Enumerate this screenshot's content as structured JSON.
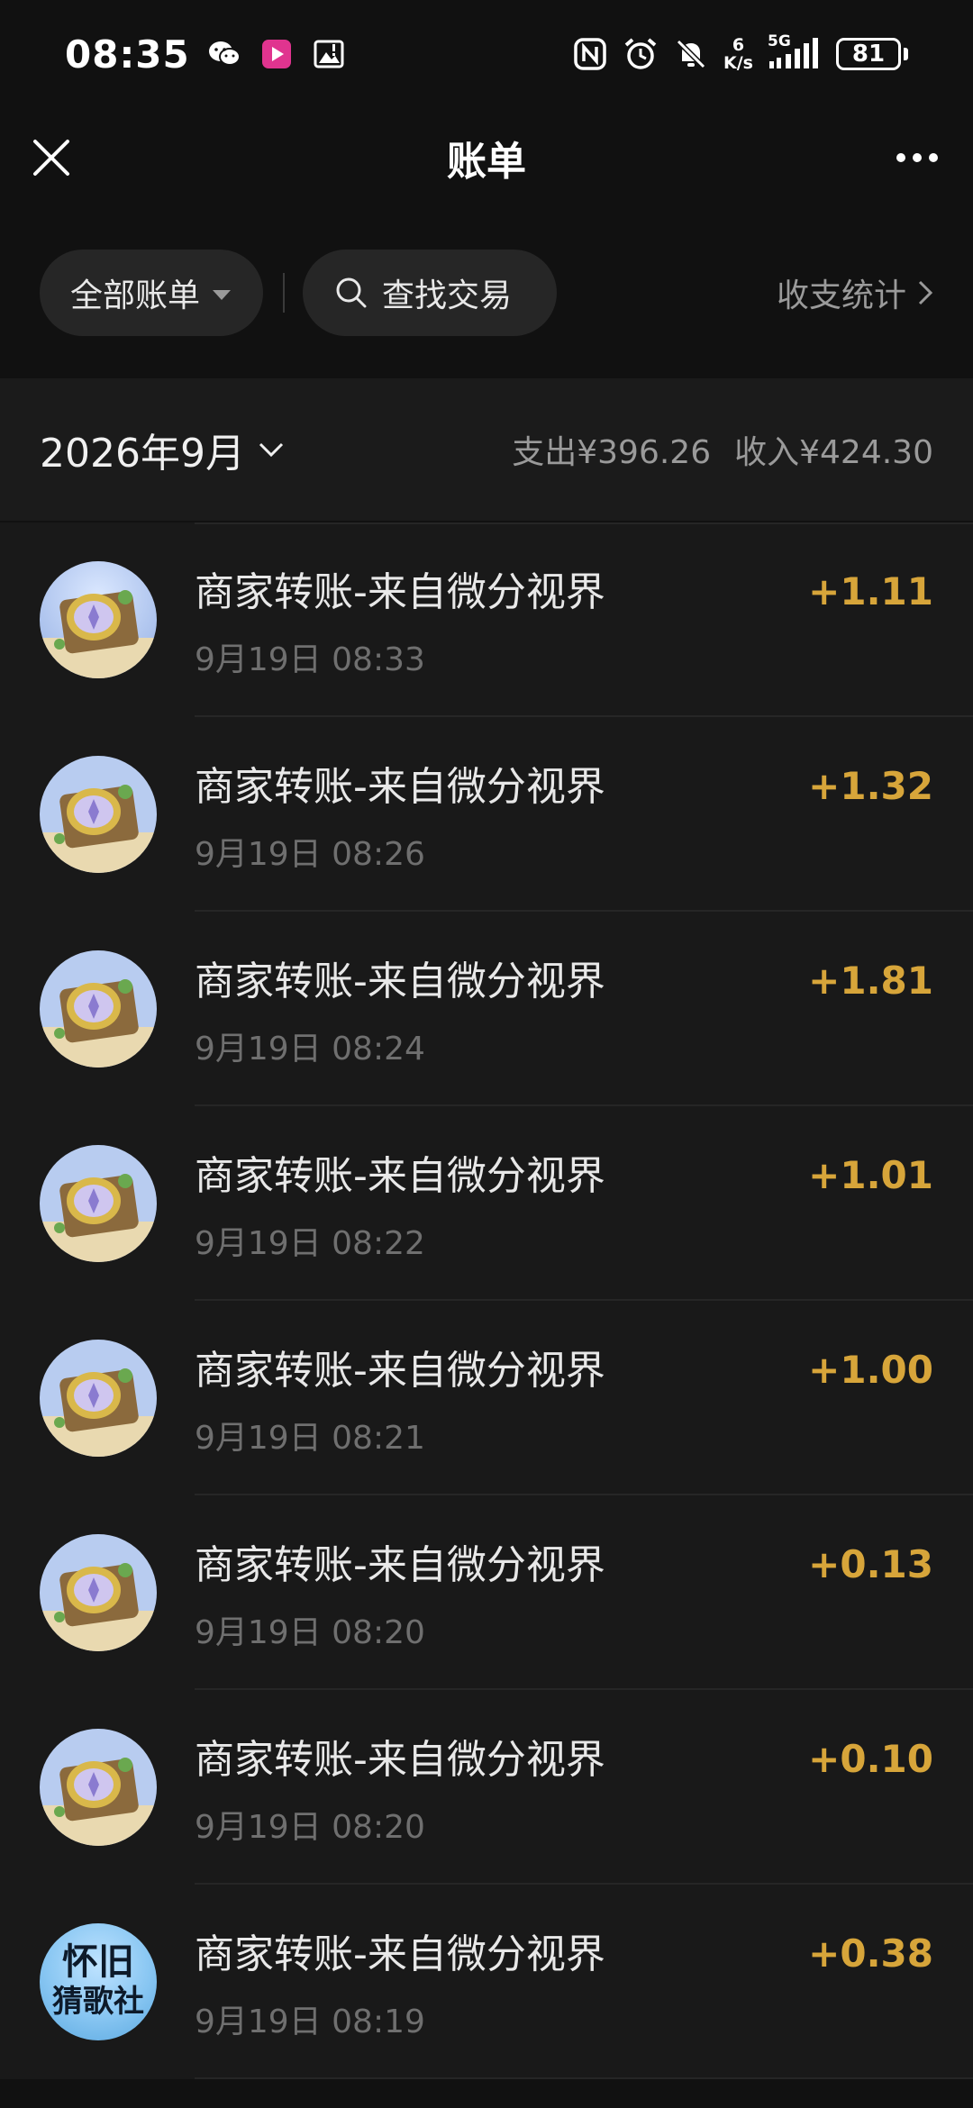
{
  "status_bar": {
    "time": "08:35",
    "network_speed_value": "6",
    "network_speed_unit": "K/s",
    "network_type": "5G",
    "battery": "81",
    "icons": [
      "wechat-icon",
      "video-app-icon",
      "image-alert-icon",
      "nfc-icon",
      "alarm-icon",
      "mute-icon",
      "signal-icon",
      "battery-icon"
    ]
  },
  "nav": {
    "title": "账单",
    "close_icon": "close-icon",
    "more_icon": "more-icon"
  },
  "filters": {
    "all_bills": "全部账单",
    "search": "查找交易",
    "stats": "收支统计"
  },
  "month": {
    "label": "2026年9月",
    "expense": "支出¥396.26",
    "income": "收入¥424.30"
  },
  "transactions": [
    {
      "title": "商家转账-来自微分视界",
      "time": "9月19日 08:33",
      "amount": "+1.11",
      "avatar": "compass"
    },
    {
      "title": "商家转账-来自微分视界",
      "time": "9月19日 08:26",
      "amount": "+1.32",
      "avatar": "compass"
    },
    {
      "title": "商家转账-来自微分视界",
      "time": "9月19日 08:24",
      "amount": "+1.81",
      "avatar": "compass"
    },
    {
      "title": "商家转账-来自微分视界",
      "time": "9月19日 08:22",
      "amount": "+1.01",
      "avatar": "compass"
    },
    {
      "title": "商家转账-来自微分视界",
      "time": "9月19日 08:21",
      "amount": "+1.00",
      "avatar": "compass"
    },
    {
      "title": "商家转账-来自微分视界",
      "time": "9月19日 08:20",
      "amount": "+0.13",
      "avatar": "compass"
    },
    {
      "title": "商家转账-来自微分视界",
      "time": "9月19日 08:20",
      "amount": "+0.10",
      "avatar": "compass"
    },
    {
      "title": "商家转账-来自微分视界",
      "time": "9月19日 08:19",
      "amount": "+0.38",
      "avatar": "song-club",
      "avatar_line1": "怀旧",
      "avatar_line2": "猜歌社"
    }
  ],
  "colors": {
    "background": "#111111",
    "income_amount": "#d7a53a"
  }
}
